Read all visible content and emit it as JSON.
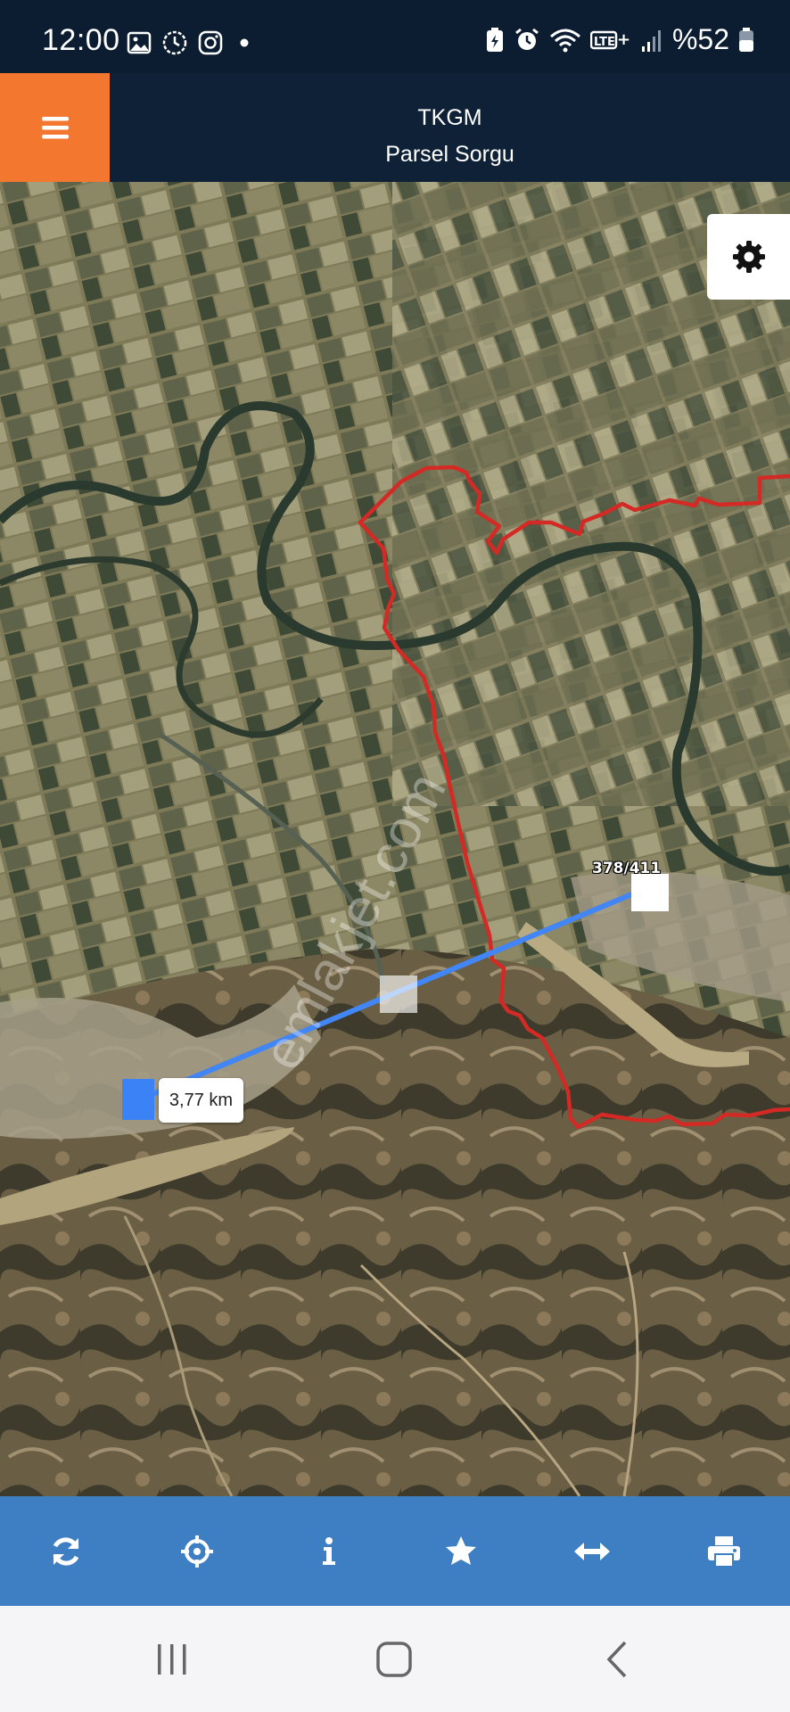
{
  "status_bar": {
    "time": "12:00",
    "battery_text": "%52",
    "left_icons": [
      "image-icon",
      "clock-icon",
      "instagram-icon",
      "dot-icon"
    ],
    "right_icons": [
      "battery-saver-icon",
      "alarm-icon",
      "wifi-icon",
      "volte-icon",
      "signal-icon",
      "battery-icon"
    ]
  },
  "header": {
    "title": "TKGM",
    "subtitle": "Parsel Sorgu",
    "menu_icon": "hamburger-icon",
    "accent_color": "#f4772f"
  },
  "map": {
    "parcel_label": "378/411",
    "distance": "3,77 km",
    "watermark": "emlakjet.com",
    "boundary_color": "#d42a25",
    "measure_line_color": "#4285f4"
  },
  "toolbar": {
    "buttons": [
      "refresh-icon",
      "locate-icon",
      "info-icon",
      "favorite-icon",
      "measure-icon",
      "print-icon"
    ],
    "color": "#3d7fc2"
  },
  "nav_bar": {
    "buttons": [
      "recent-apps-icon",
      "home-icon",
      "back-icon"
    ]
  }
}
